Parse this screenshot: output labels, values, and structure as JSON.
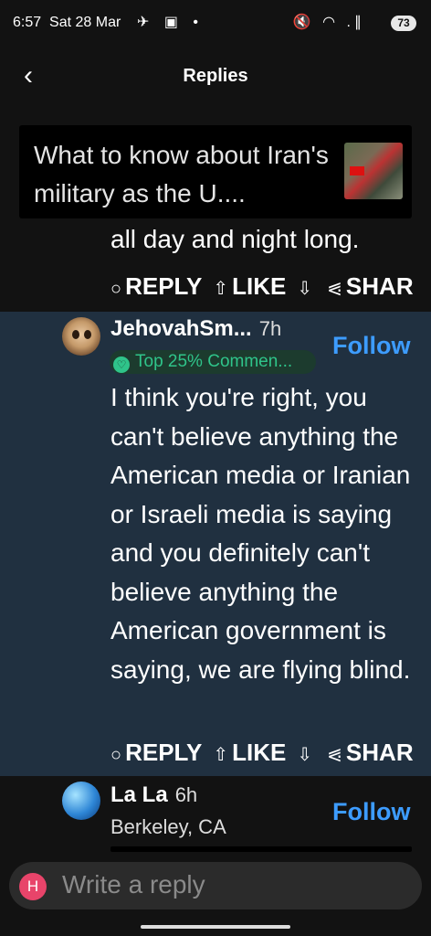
{
  "status_bar": {
    "time": "6:57",
    "date": "Sat 28 Mar",
    "left_icons": "✈ ▣ •",
    "right_icons": "🔇 ◠ .∥",
    "battery": "73"
  },
  "header": {
    "back_icon": "‹",
    "title": "Replies"
  },
  "article": {
    "title": "What to know about Iran's military as the U...."
  },
  "previous_comment": {
    "last_line": "all day and night long.",
    "actions": {
      "reply": "REPLY",
      "like": "LIKE",
      "share": "SHAR"
    }
  },
  "comments": [
    {
      "username": "JehovahSm...",
      "time": "7h",
      "badge": "Top 25% Commen...",
      "follow": "Follow",
      "text": "I think you're right, you can't believe anything the American media or Iranian or Israeli media is saying and you definitely can't believe anything the American government is saying, we are flying blind.",
      "actions": {
        "reply": "REPLY",
        "like": "LIKE",
        "share": "SHAR"
      }
    },
    {
      "username": "La La",
      "time": "6h",
      "location": "Berkeley, CA",
      "follow": "Follow"
    }
  ],
  "reply_bar": {
    "avatar_letter": "H",
    "placeholder": "Write a reply"
  },
  "colors": {
    "background": "#121212",
    "highlight": "#203040",
    "accent": "#3d9cff",
    "badge_green": "#2fc48a",
    "avatar_h": "#e8446a"
  }
}
